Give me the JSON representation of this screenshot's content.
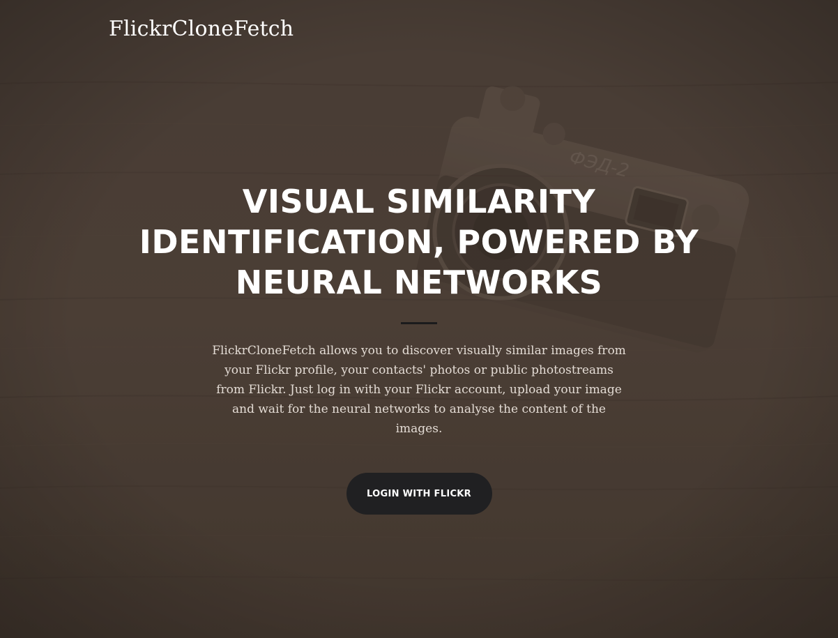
{
  "header": {
    "brand": "FlickrCloneFetch"
  },
  "hero": {
    "title": "VISUAL SIMILARITY IDENTIFICATION, POWERED BY NEURAL NETWORKS",
    "description": "FlickrCloneFetch allows you to discover visually similar images from your Flickr profile, your contacts' photos or public photostreams from Flickr. Just log in with your Flickr account, upload your image and wait for the neural networks to analyse the content of the images.",
    "button_label": "LOGIN WITH FLICKR",
    "camera_lettering": "ФЭД-2"
  },
  "icons": {
    "background": "camera-on-wood-photo"
  },
  "colors": {
    "overlay": "#4e4239",
    "button_bg": "#202022",
    "divider": "#1b1b1c",
    "title_text": "#ffffff",
    "body_text": "#e4dcd5"
  }
}
